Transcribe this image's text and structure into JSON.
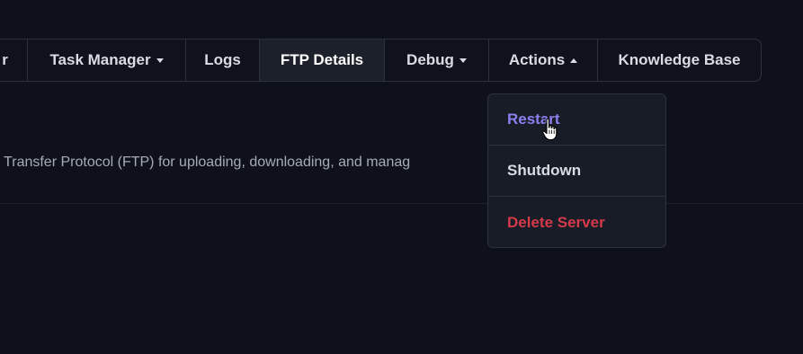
{
  "tabs": [
    {
      "label": "r",
      "has_caret": false
    },
    {
      "label": "Task Manager",
      "has_caret": true
    },
    {
      "label": "Logs",
      "has_caret": false
    },
    {
      "label": "FTP Details",
      "has_caret": false,
      "active": true
    },
    {
      "label": "Debug",
      "has_caret": true
    },
    {
      "label": "Actions",
      "has_caret": true,
      "open": true
    },
    {
      "label": "Knowledge Base",
      "has_caret": false
    }
  ],
  "description": "e Transfer Protocol (FTP) for uploading, downloading, and manag",
  "actions_menu": {
    "items": [
      {
        "label": "Restart",
        "state": "hover",
        "color": "#8e7ff0"
      },
      {
        "label": "Shutdown",
        "state": "normal",
        "color": "#d9dce3"
      },
      {
        "label": "Delete Server",
        "state": "danger",
        "color": "#d53a4a"
      }
    ]
  },
  "colors": {
    "background": "#0e111b",
    "border": "#2c313d",
    "accent": "#8e7ff0",
    "danger": "#d53a4a"
  },
  "icons": {
    "cursor": "hand-pointer-icon"
  }
}
